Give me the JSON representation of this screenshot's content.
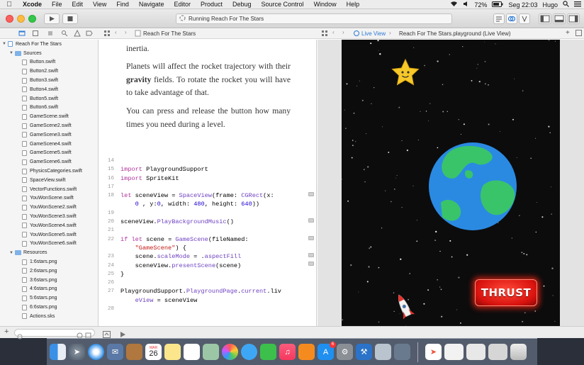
{
  "menubar": {
    "apple": "",
    "app_name": "Xcode",
    "items": [
      "File",
      "Edit",
      "View",
      "Find",
      "Navigate",
      "Editor",
      "Product",
      "Debug",
      "Source Control",
      "Window",
      "Help"
    ],
    "battery": "72%",
    "clock": "Seg 22:03",
    "user": "Hugo"
  },
  "toolbar": {
    "activity": "Running Reach For The Stars"
  },
  "editor_path": {
    "left": "Reach For The Stars",
    "right_view": "Live View",
    "right_file": "Reach For The Stars.playground (Live View)"
  },
  "navigator": {
    "project": "Reach For The Stars",
    "sources_label": "Sources",
    "sources": [
      "Button.swift",
      "Button2.swift",
      "Button3.swift",
      "Button4.swift",
      "Button5.swift",
      "Button6.swift",
      "GameScene.swift",
      "GameScene2.swift",
      "GameScene3.swift",
      "GameScene4.swift",
      "GameScene5.swift",
      "GameScene6.swift",
      "PhysicsCategories.swift",
      "SpaceView.swift",
      "VectorFunctions.swift",
      "YouWonScene.swift",
      "YouWonScene2.swift",
      "YouWonScene3.swift",
      "YouWonScene4.swift",
      "YouWonScene5.swift",
      "YouWonScene6.swift"
    ],
    "resources_label": "Resources",
    "resources": [
      "1:6stars.png",
      "2:6stars.png",
      "3:6stars.png",
      "4:6stars.png",
      "5:6stars.png",
      "6:6stars.png",
      "Actions.sks"
    ]
  },
  "prose": {
    "line0": "inertia.",
    "p1_a": "Planets will affect the rocket trajectory with their ",
    "p1_bold": "gravity",
    "p1_b": " fields. To rotate the rocket you will have to take advantage of that.",
    "p2": "You can press and release the button how many times you need during a level."
  },
  "code": {
    "line_numbers": [
      "14",
      "15",
      "16",
      "17",
      "18",
      "",
      "19",
      "20",
      "21",
      "22",
      "",
      "23",
      "24",
      "25",
      "26",
      "27",
      "",
      "28"
    ],
    "l15_kw": "import",
    "l15_rest": " PlaygroundSupport",
    "l16_kw": "import",
    "l16_rest": " SpriteKit",
    "l18_kw": "let",
    "l18_a": " sceneView = ",
    "l18_type": "SpaceView",
    "l18_b": "(frame: ",
    "l18_type2": "CGRect",
    "l18_c": "(x:",
    "l18b_num1": "0",
    "l18b_a": " , y:",
    "l18b_num2": "0",
    "l18b_b": ", width: ",
    "l18b_num3": "480",
    "l18b_c": ", height: ",
    "l18b_num4": "640",
    "l18b_d": "))",
    "l20": "sceneView.",
    "l20_fn": "PlayBackgroundMusic",
    "l20_end": "()",
    "l22_kw1": "if",
    "l22_kw2": "let",
    "l22_a": " scene = ",
    "l22_type": "GameScene",
    "l22_b": "(fileNamed:",
    "l22b_str": "\"GameScene\"",
    "l22b_a": ") {",
    "l23_a": "scene.",
    "l23_prop": "scaleMode",
    "l23_b": " = .",
    "l23_val": "aspectFill",
    "l24_a": "sceneView.",
    "l24_fn": "presentScene",
    "l24_b": "(scene)",
    "l25": "}",
    "l27_a": "PlaygroundSupport.",
    "l27_type": "PlaygroundPage",
    "l27_b": ".",
    "l27_c": "current",
    "l27_d": ".liv",
    "l27b_a": "eView",
    "l27b_b": " = sceneView"
  },
  "game": {
    "thrust_label": "THRUST"
  },
  "dock": {
    "calendar_month": "MAR",
    "calendar_day": "26",
    "facetime_badge": "",
    "appstore_badge": "6"
  },
  "colors": {
    "keyword": "#b0329b",
    "type": "#6f42c1",
    "number": "#1c00cf",
    "string": "#c41a16",
    "thrust_red": "#e8201c",
    "planet_blue": "#2a8ae2",
    "planet_green": "#39c46a"
  }
}
